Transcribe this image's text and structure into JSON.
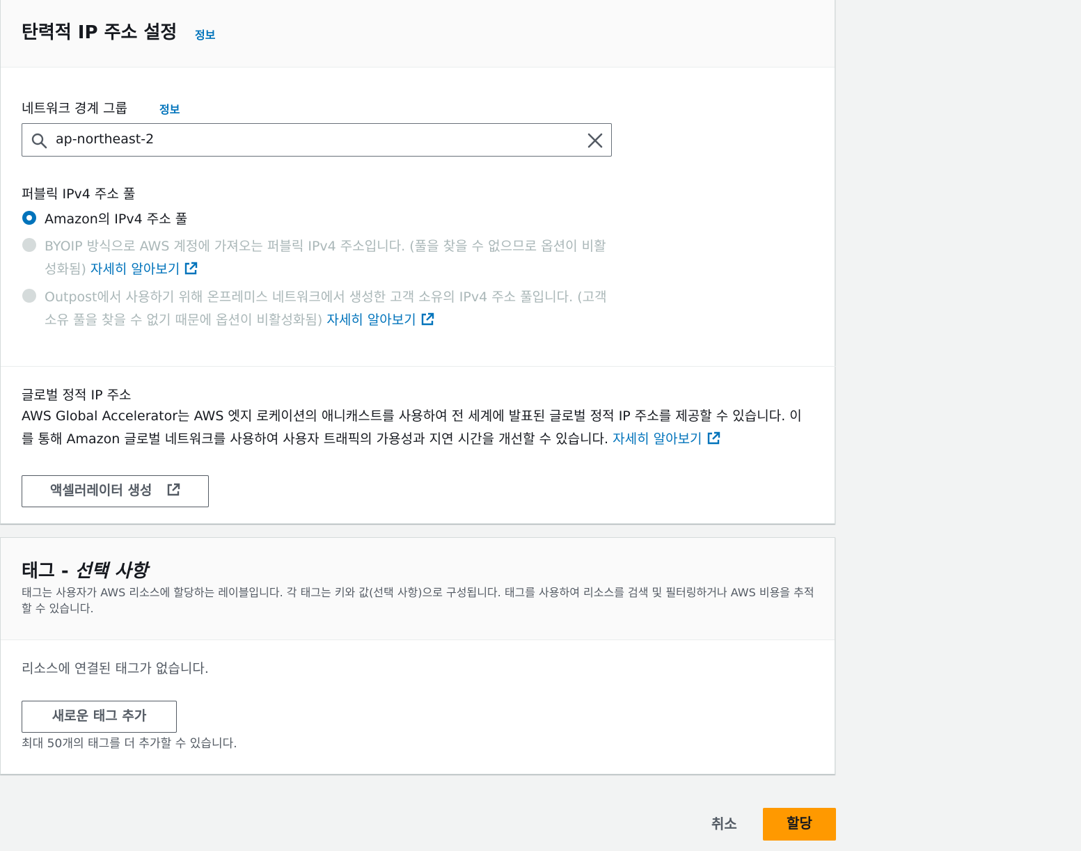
{
  "eip_panel": {
    "title": "탄력적 IP 주소 설정",
    "info": "정보",
    "network_border_group": {
      "label": "네트워크 경계 그룹",
      "info": "정보",
      "value": "ap-northeast-2",
      "search_icon": "search-icon",
      "clear_icon": "close-icon"
    },
    "pool": {
      "label": "퍼블릭 IPv4 주소 풀",
      "options": [
        {
          "text": "Amazon의 IPv4 주소 풀",
          "checked": true,
          "disabled": false
        },
        {
          "text": "BYOIP 방식으로 AWS 계정에 가져오는 퍼블릭 IPv4 주소입니다. (풀을 찾을 수 없으므로 옵션이 비활성화됨)",
          "link": "자세히 알아보기",
          "checked": false,
          "disabled": true
        },
        {
          "text": "Outpost에서 사용하기 위해 온프레미스 네트워크에서 생성한 고객 소유의 IPv4 주소 풀입니다. (고객 소유 풀을 찾을 수 없기 때문에 옵션이 비활성화됨)",
          "link": "자세히 알아보기",
          "checked": false,
          "disabled": true
        }
      ]
    },
    "global_static": {
      "label": "글로벌 정적 IP 주소",
      "description": "AWS Global Accelerator는 AWS 엣지 로케이션의 애니캐스트를 사용하여 전 세계에 발표된 글로벌 정적 IP 주소를 제공할 수 있습니다. 이를 통해 Amazon 글로벌 네트워크를 사용하여 사용자 트래픽의 가용성과 지연 시간을 개선할 수 있습니다.",
      "link": "자세히 알아보기",
      "button": "액셀러레이터 생성"
    }
  },
  "tags_panel": {
    "title_main": "태그 - ",
    "title_optional": "선택 사항",
    "description": "태그는 사용자가 AWS 리소스에 할당하는 레이블입니다. 각 태그는 키와 값(선택 사항)으로 구성됩니다. 태그를 사용하여 리소스를 검색 및 필터링하거나 AWS 비용을 추적할 수 있습니다.",
    "empty_text": "리소스에 연결된 태그가 없습니다.",
    "add_button": "새로운 태그 추가",
    "limit_text": "최대 50개의 태그를 더 추가할 수 있습니다."
  },
  "footer": {
    "cancel": "취소",
    "submit": "할당"
  },
  "colors": {
    "accent_link": "#0073bb",
    "primary_button": "#ff9900",
    "disabled_text": "#aab7b8"
  }
}
